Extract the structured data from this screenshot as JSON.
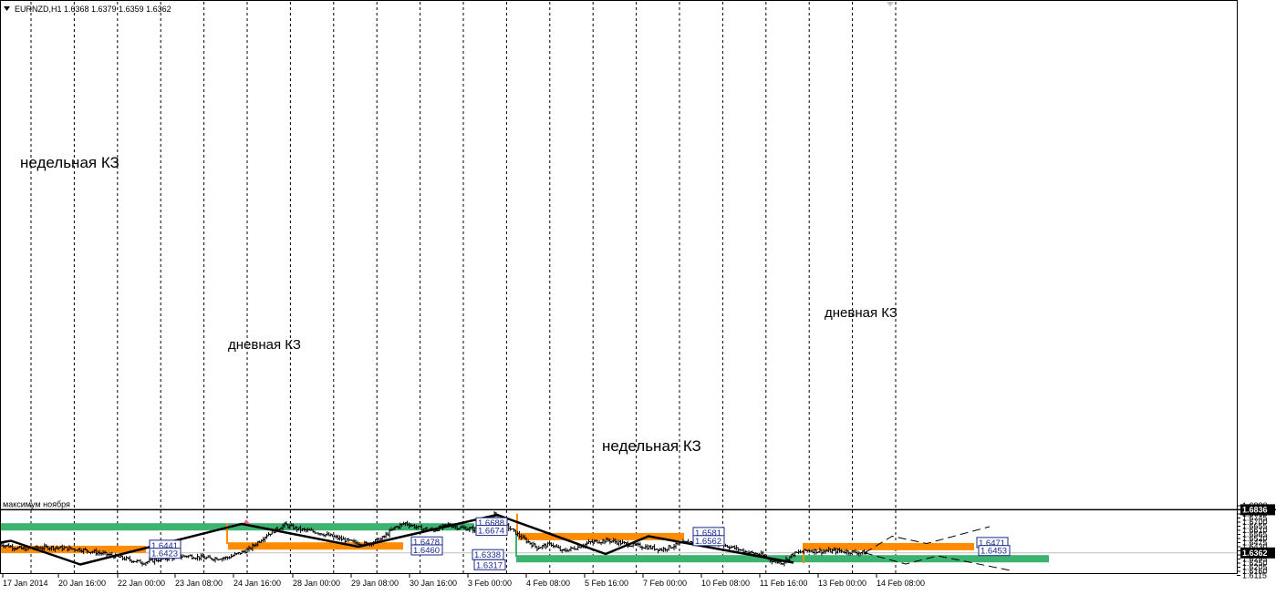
{
  "header": {
    "symbol_info": "EURNZD,H1  1.6368 1.6379 1.6359 1.6362",
    "dropdown_icon": "triangle-down-icon"
  },
  "hline_label": "максимум ноября",
  "chart_data": {
    "type": "candlestick",
    "symbol": "EURNZD",
    "timeframe": "H1",
    "ohlc_last": {
      "open": 1.6368,
      "high": 1.6379,
      "low": 1.6359,
      "close": 1.6362
    },
    "current_price": "1.6362",
    "max_line_price": 1.6836,
    "max_line_price_text": "1.6836",
    "ylim": [
      1.6115,
      1.6925
    ],
    "y_ticks": [
      "1.6880",
      "1.6835",
      "1.6790",
      "1.6745",
      "1.6700",
      "1.6655",
      "1.6610",
      "1.6565",
      "1.6520",
      "1.6475",
      "1.6430",
      "1.6385",
      "1.6340",
      "1.6295",
      "1.6250",
      "1.6205",
      "1.6160",
      "1.6115"
    ],
    "x_ticks": [
      "17 Jan 2014",
      "20 Jan 16:00",
      "22 Jan 00:00",
      "23 Jan 08:00",
      "24 Jan 16:00",
      "28 Jan 00:00",
      "29 Jan 08:00",
      "30 Jan 16:00",
      "3 Feb 00:00",
      "4 Feb 08:00",
      "5 Feb 16:00",
      "7 Feb 00:00",
      "10 Feb 08:00",
      "11 Feb 16:00",
      "13 Feb 00:00",
      "14 Feb 08:00"
    ],
    "bars_count": 320,
    "price_path": [
      [
        0,
        1.646
      ],
      [
        12,
        1.6405
      ],
      [
        28,
        1.6425
      ],
      [
        45,
        1.64
      ],
      [
        60,
        1.6345
      ],
      [
        72,
        1.629
      ],
      [
        80,
        1.6255
      ],
      [
        92,
        1.63
      ],
      [
        105,
        1.633
      ],
      [
        118,
        1.63
      ],
      [
        128,
        1.631
      ],
      [
        140,
        1.64
      ],
      [
        150,
        1.656
      ],
      [
        160,
        1.667
      ],
      [
        168,
        1.662
      ],
      [
        178,
        1.659
      ],
      [
        188,
        1.6535
      ],
      [
        198,
        1.648
      ],
      [
        206,
        1.646
      ],
      [
        214,
        1.651
      ],
      [
        222,
        1.664
      ],
      [
        228,
        1.669
      ],
      [
        236,
        1.663
      ],
      [
        244,
        1.661
      ],
      [
        252,
        1.667
      ],
      [
        258,
        1.664
      ],
      [
        266,
        1.662
      ],
      [
        272,
        1.664
      ],
      [
        278,
        1.679
      ],
      [
        281,
        1.672
      ],
      [
        286,
        1.664
      ],
      [
        294,
        1.652
      ],
      [
        302,
        1.642
      ],
      [
        310,
        1.646
      ],
      [
        316,
        1.638
      ],
      [
        324,
        1.642
      ],
      [
        332,
        1.648
      ],
      [
        342,
        1.65
      ],
      [
        352,
        1.646
      ],
      [
        362,
        1.643
      ],
      [
        372,
        1.64
      ],
      [
        384,
        1.647
      ],
      [
        394,
        1.65
      ],
      [
        402,
        1.648
      ],
      [
        412,
        1.642
      ],
      [
        420,
        1.637
      ],
      [
        428,
        1.634
      ],
      [
        434,
        1.628
      ],
      [
        440,
        1.6255
      ],
      [
        446,
        1.635
      ],
      [
        454,
        1.639
      ],
      [
        462,
        1.638
      ],
      [
        470,
        1.6385
      ],
      [
        480,
        1.637
      ],
      [
        487,
        1.6362
      ]
    ],
    "weekly_zones": [
      {
        "label": "недельная КЗ",
        "upper": 1.6688,
        "lower": 1.6674,
        "upper_text": "1.6688",
        "lower_text": "1.6674"
      },
      {
        "label": "недельная КЗ",
        "upper": 1.6338,
        "lower": 1.6317,
        "upper_text": "1.6338",
        "lower_text": "1.6317"
      }
    ],
    "daily_zones": [
      {
        "label": "",
        "upper": 1.6441,
        "lower": 1.6423,
        "upper_text": "1.6441",
        "lower_text": "1.6423"
      },
      {
        "label": "дневная КЗ",
        "upper": 1.6478,
        "lower": 1.646,
        "upper_text": "1.6478",
        "lower_text": "1.6460"
      },
      {
        "label": "",
        "upper": 1.6581,
        "lower": 1.6562,
        "upper_text": "1.6581",
        "lower_text": "1.6562"
      },
      {
        "label": "дневная КЗ",
        "upper": 1.6471,
        "lower": 1.6453,
        "upper_text": "1.6471",
        "lower_text": "1.6453"
      }
    ],
    "zigzag": [
      1.6495,
      1.6235,
      1.668,
      1.643,
      1.678,
      1.635,
      1.6545,
      1.6255
    ],
    "projection": [
      1.6362,
      1.6545,
      1.6465,
      1.665,
      1.6362,
      1.624,
      1.633,
      1.6165
    ],
    "colors": {
      "candles": "#000000",
      "weekly_zone": "#3cb371",
      "daily_zone": "#ff8c00",
      "zigzag": "#000000",
      "grid": "#000000",
      "max_line": "#000000",
      "current_price_bg": "#000000"
    }
  }
}
